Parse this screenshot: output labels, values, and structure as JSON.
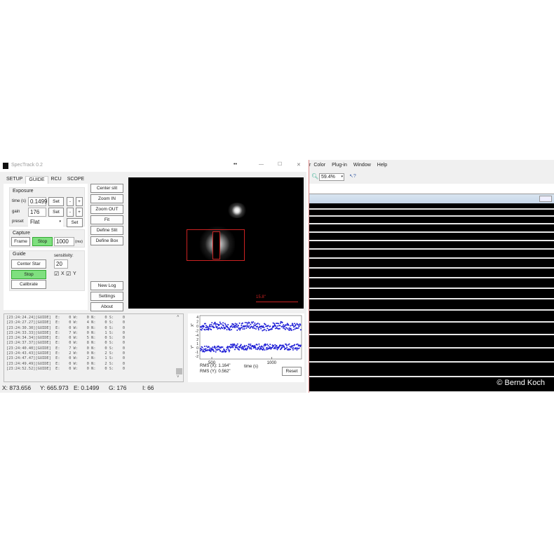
{
  "window": {
    "title": "SpecTrack 0.2",
    "title_center": "••",
    "controls": {
      "minimize": "—",
      "maximize": "☐",
      "close": "✕"
    }
  },
  "tabs": [
    {
      "label": "SETUP"
    },
    {
      "label": "GUIDE",
      "active": true
    },
    {
      "label": "RCU"
    },
    {
      "label": "SCOPE"
    }
  ],
  "exposure": {
    "label": "Exposure",
    "time_label": "time (s)",
    "time_value": "0.1499",
    "gain_label": "gain",
    "gain_value": "176",
    "preset_label": "preset",
    "preset_value": "Flat",
    "set": "Set",
    "minus": "-",
    "plus": "+"
  },
  "capture": {
    "label": "Capture",
    "frame": "Frame",
    "stop": "Stop",
    "interval": "1000",
    "unit": "(ms)"
  },
  "guide": {
    "label": "Guide",
    "center_star": "Center Star",
    "stop": "Stop",
    "calibrate": "Calibrate",
    "sensitivity_label": "sensitivity:",
    "sensitivity_value": "20",
    "x_label": "X",
    "y_label": "Y",
    "x_checked": true,
    "y_checked": true
  },
  "side_buttons": [
    "Center slit",
    "Zoom IN",
    "Zoom OUT",
    "Fit",
    "Define Slit",
    "Define Box"
  ],
  "side_buttons_bottom": [
    "New Log",
    "Settings",
    "About"
  ],
  "camera": {
    "scale_label": "15.8\""
  },
  "log": [
    "[23:24:24.24][GUIDE]  E:    0 W:    0 N:    0 S:    0",
    "[23:24:27.27][GUIDE]  E:    0 W:    4 N:    0 S:    0",
    "[23:24:30.30][GUIDE]  E:    0 W:    0 N:    0 S:    0",
    "[23:24:33.33][GUIDE]  E:    7 W:    0 N:    1 S:    0",
    "[23:24:34.34][GUIDE]  E:    0 W:    5 N:    0 S:    0",
    "[23:24:37.37][GUIDE]  E:    0 W:    8 N:    0 S:    0",
    "[23:24:40.40][GUIDE]  E:    7 W:    0 N:    0 S:    0",
    "[23:24:43.43][GUIDE]  E:    2 W:    0 N:    2 S:    0",
    "[23:24:47.47][GUIDE]  E:    0 W:    2 N:    1 S:    0",
    "[23:24:49.49][GUIDE]  E:    0 W:    0 N:    2 S:    0",
    "[23:24:52.52][GUIDE]  E:    0 W:    0 N:    0 S:    0"
  ],
  "status": {
    "x": "X:  873.656",
    "y": "Y:  665.973",
    "e": "E:  0.1499",
    "g": "G:  176",
    "i": "I:  66"
  },
  "plot": {
    "x_axis_label": "X\"",
    "y_axis_label": "Y\"",
    "x_ticks": [
      "4",
      "2",
      "0",
      "-2",
      "-4"
    ],
    "y_ticks": [
      "2",
      "1",
      "0",
      "-1",
      "-2"
    ],
    "time_ticks": [
      "500",
      "1000"
    ],
    "time_label": "time (s)",
    "rms_x": "RMS (X): 1.164\"",
    "rms_y": "RMS (Y): 0.562\"",
    "reset": "Reset",
    "point_color": "#1f1fd6"
  },
  "right_app": {
    "menu": [
      "r",
      "Color",
      "Plug-in",
      "Window",
      "Help"
    ],
    "zoom_value": "59.4%",
    "copyright": "© Bernd Koch"
  }
}
